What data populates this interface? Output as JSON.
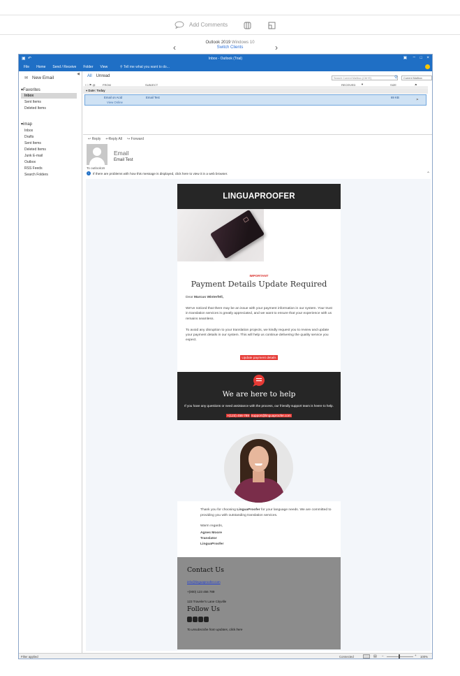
{
  "toolbar": {
    "add_comments_label": "Add Comments"
  },
  "client_switch": {
    "client_name": "Outlook 2019",
    "platform": "Windows 10",
    "switch_label": "Switch Clients"
  },
  "window": {
    "title": "Inbox - Outlook (Trial)",
    "ribbon_tabs": [
      "File",
      "Home",
      "Send / Receive",
      "Folder",
      "View"
    ],
    "tell_me": "Tell me what you want to do..."
  },
  "nav": {
    "new_email": "New Email",
    "favorites_header": "Favorites",
    "favorites": [
      "Inbox",
      "Sent Items",
      "Deleted Items"
    ],
    "imap_header": "imap",
    "imap_folders": [
      "Inbox",
      "Drafts",
      "Sent Items",
      "Deleted Items",
      "Junk E-mail",
      "Outbox",
      "RSS Feeds",
      "Search Folders"
    ]
  },
  "list": {
    "filter_all": "All",
    "filter_unread": "Unread",
    "search_placeholder": "Search Current Mailbox (Ctrl+E)",
    "scope": "Current Mailbox",
    "columns": [
      "FROM",
      "SUBJECT",
      "RECEIVED",
      "SIZE"
    ],
    "group_header": "Date: Today",
    "message": {
      "from": "Email on Acid",
      "view_online": "View Online",
      "subject": "Email Test",
      "size": "69 KB"
    }
  },
  "reading": {
    "actions": [
      "Reply",
      "Reply All",
      "Forward"
    ],
    "sender": "Email",
    "subject": "Email Test",
    "to_label": "To",
    "to_value": "outlook16",
    "info": "If there are problems with how this message is displayed, click here to view it in a web browser."
  },
  "email": {
    "brand": "LINGUAPROOFER",
    "tag": "IMPORTANT",
    "heading": "Payment Details Update Required",
    "greeting_prefix": "Dear ",
    "greeting_name": "Marcus Winterfell,",
    "para1": "We've noticed that there may be an issue with your payment information in our system. Your trust in translation services is greatly appreciated, and we want to ensure that your experience with us remains seamless.",
    "para2": "To avoid any disruption to your translation projects, we kindly request you to review and update your payment details in our system. This will help us continue delivering the quality service you expect.",
    "cta": "Update payment details",
    "help_title": "We are here to help",
    "help_text": "If you have any questions or need assistance with the process, our friendly support team is heere to help.",
    "help_phone": "+(123) 456-789",
    "help_email": "support@linguaproofer.com",
    "thanks_prefix": "Thank you for choosing ",
    "thanks_brand": "LinguaProofer",
    "thanks_suffix": " for your language needs. We are committed to providing you with outstanding translation services.",
    "regards": "Warm regards,",
    "sig_name": "Agnes Moore",
    "sig_title": "Translator",
    "sig_company": "LinguaProofer",
    "contact_title": "Contact Us",
    "contact_email": "info@linguaproofer.com",
    "contact_phone": "+(000) 123 456 789",
    "contact_address": "123 Traveler's Lane Cityville",
    "follow_title": "Follow Us",
    "unsubscribe": "To unsubscribe from updates, click here"
  },
  "status": {
    "left": "Filter applied",
    "connected": "Connected",
    "zoom": "100%"
  }
}
